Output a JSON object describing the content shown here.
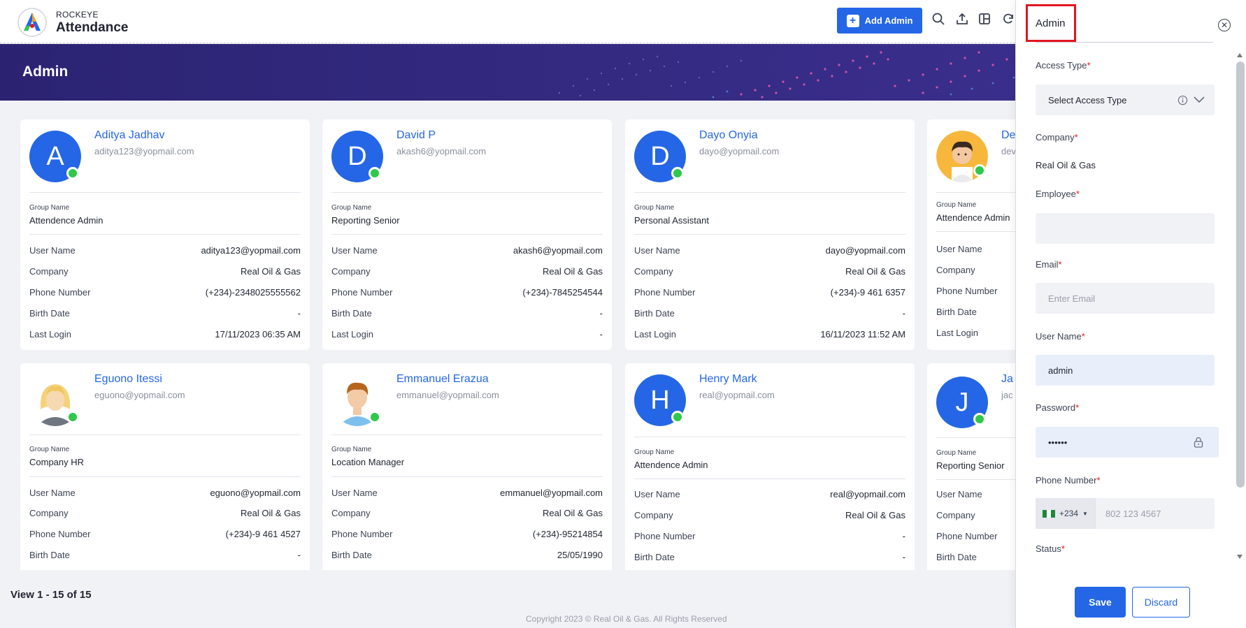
{
  "header": {
    "brand_top": "ROCKEYE",
    "brand_name": "Attendance",
    "add_admin_label": "Add Admin"
  },
  "banner": {
    "title": "Admin"
  },
  "card_labels": {
    "group_name": "Group Name",
    "user_name": "User Name",
    "company": "Company",
    "phone_number": "Phone Number",
    "birth_date": "Birth Date",
    "last_login": "Last Login"
  },
  "cards": [
    {
      "initial": "A",
      "name": "Aditya Jadhav",
      "email": "aditya123@yopmail.com",
      "group": "Attendence Admin",
      "user_name": "aditya123@yopmail.com",
      "company": "Real Oil & Gas",
      "phone": "(+234)-2348025555562",
      "birth": "-",
      "last_login": "17/11/2023 06:35 AM"
    },
    {
      "initial": "D",
      "name": "David P",
      "email": "akash6@yopmail.com",
      "group": "Reporting Senior",
      "user_name": "akash6@yopmail.com",
      "company": "Real Oil & Gas",
      "phone": "(+234)-7845254544",
      "birth": "-",
      "last_login": "-"
    },
    {
      "initial": "D",
      "name": "Dayo Onyia",
      "email": "dayo@yopmail.com",
      "group": "Personal Assistant",
      "user_name": "dayo@yopmail.com",
      "company": "Real Oil & Gas",
      "phone": "(+234)-9 461 6357",
      "birth": "-",
      "last_login": "16/11/2023 11:52 AM"
    },
    {
      "initial": "",
      "name": "De",
      "email": "dev",
      "group": "Attendence Admin",
      "user_name": "",
      "company": "",
      "phone": "",
      "birth": "",
      "last_login": ""
    },
    {
      "initial": "",
      "name": "Eguono Itessi",
      "email": "eguono@yopmail.com",
      "group": "Company HR",
      "user_name": "eguono@yopmail.com",
      "company": "Real Oil & Gas",
      "phone": "(+234)-9 461 4527",
      "birth": "-"
    },
    {
      "initial": "",
      "name": "Emmanuel Erazua",
      "email": "emmanuel@yopmail.com",
      "group": "Location Manager",
      "user_name": "emmanuel@yopmail.com",
      "company": "Real Oil & Gas",
      "phone": "(+234)-95214854",
      "birth": "25/05/1990"
    },
    {
      "initial": "H",
      "name": "Henry Mark",
      "email": "real@yopmail.com",
      "group": "Attendence Admin",
      "user_name": "real@yopmail.com",
      "company": "Real Oil & Gas",
      "phone": "-",
      "birth": "-"
    },
    {
      "initial": "J",
      "name": "Ja",
      "email": "jac",
      "group": "Reporting Senior",
      "user_name": "",
      "company": "",
      "phone": "",
      "birth": ""
    }
  ],
  "footer": {
    "view_count": "View 1 - 15 of 15",
    "copyright": "Copyright 2023 © Real Oil & Gas. All Rights Reserved"
  },
  "panel": {
    "title": "Admin",
    "access_type_label": "Access Type",
    "access_type_placeholder": "Select Access Type",
    "company_label": "Company",
    "company_value": "Real Oil & Gas",
    "employee_label": "Employee",
    "email_label": "Email",
    "email_placeholder": "Enter Email",
    "username_label": "User Name",
    "username_value": "admin",
    "password_label": "Password",
    "password_value": "••••••",
    "phone_label": "Phone Number",
    "phone_code": "+234",
    "phone_placeholder": "802 123 4567",
    "status_label": "Status",
    "required_mark": "*",
    "save_label": "Save",
    "discard_label": "Discard"
  },
  "colors": {
    "accent": "#2466e6",
    "banner": "#2b2372",
    "online": "#2fc84a",
    "highlight": "#e2161d"
  }
}
